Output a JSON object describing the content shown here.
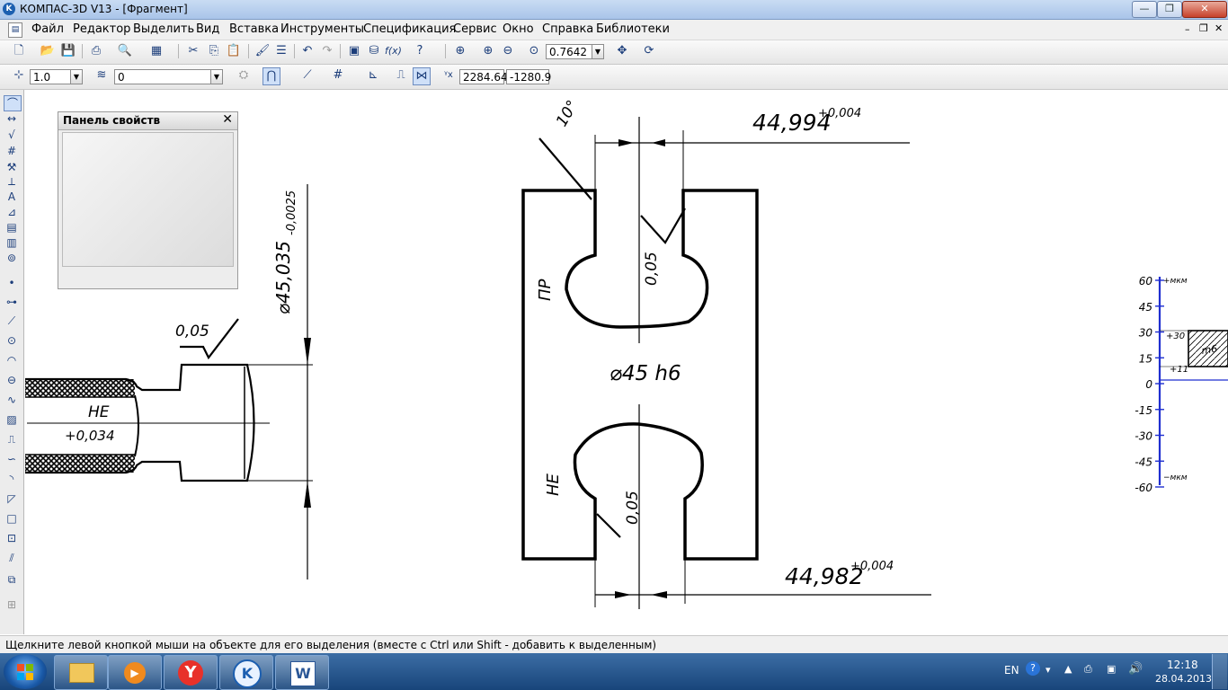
{
  "window": {
    "title": "КОМПАС-3D V13 - [Фрагмент]",
    "app_icon": "kompas-logo-icon"
  },
  "menu": [
    "Файл",
    "Редактор",
    "Выделить",
    "Вид",
    "Вставка",
    "Инструменты",
    "Спецификация",
    "Сервис",
    "Окно",
    "Справка",
    "Библиотеки"
  ],
  "toolbar1": {
    "zoom_value": "0.7642"
  },
  "toolbar2": {
    "step_value": "1.0",
    "layer_value": "0",
    "coord_x": "2284.64",
    "coord_y": "-1280.9"
  },
  "properties_panel": {
    "title": "Панель свойств",
    "close_glyph": "✕"
  },
  "drawing": {
    "dim_top": "44,994",
    "tol_top": "+0,004",
    "dim_bottom": "44,982",
    "tol_bottom": "+0,004",
    "rough_top": "0,05",
    "rough_bottom": "0,05",
    "rough_part": "0,05",
    "label_pr": "ПР",
    "label_ne_gauge": "НЕ",
    "label_ne_part": "НЕ",
    "part_tol": "+0,034",
    "gauge_dia": "⌀45 h6",
    "diameter_main": "⌀45,035",
    "diameter_tol": "-0,0025",
    "angle_mark": "10°"
  },
  "tolerance_scale": {
    "unit_top": "+мкм",
    "unit_bottom": "−мкм",
    "ticks": [
      "60",
      "45",
      "30",
      "15",
      "0",
      "-15",
      "-30",
      "-45",
      "-60"
    ],
    "upper_dev": "+30",
    "lower_dev": "+11",
    "field_label": "m6"
  },
  "statusbar": {
    "text": "Щелкните левой кнопкой мыши на объекте для его выделения (вместе с Ctrl или Shift - добавить к выделенным)"
  },
  "taskbar": {
    "lang": "EN",
    "time": "12:18",
    "date": "28.04.2013",
    "apps": [
      "explorer-icon",
      "media-player-icon",
      "yandex-browser-icon",
      "kompas-icon",
      "word-icon"
    ]
  }
}
